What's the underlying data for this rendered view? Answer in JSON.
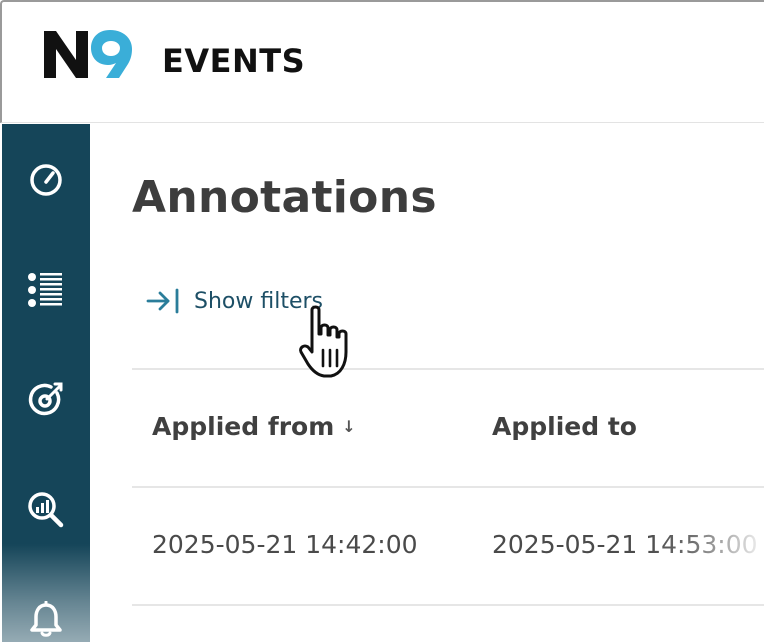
{
  "header": {
    "logo_text": "N9",
    "title": "EVENTS"
  },
  "sidebar": {
    "items": [
      {
        "icon": "speedometer-icon"
      },
      {
        "icon": "list-icon"
      },
      {
        "icon": "target-icon"
      },
      {
        "icon": "search-chart-icon"
      },
      {
        "icon": "bell-icon"
      }
    ]
  },
  "main": {
    "page_title": "Annotations",
    "filter_toggle_label": "Show filters",
    "table": {
      "columns": [
        {
          "label": "Applied from",
          "sort": "descending"
        },
        {
          "label": "Applied to"
        }
      ],
      "rows": [
        [
          "2025-05-21 14:42:00",
          "2025-05-21 14:53:00"
        ]
      ]
    }
  },
  "colors": {
    "sidebar_bg": "#154559",
    "logo_dark": "#111111",
    "logo_accent": "#3aaed8",
    "link": "#1d4f66"
  }
}
